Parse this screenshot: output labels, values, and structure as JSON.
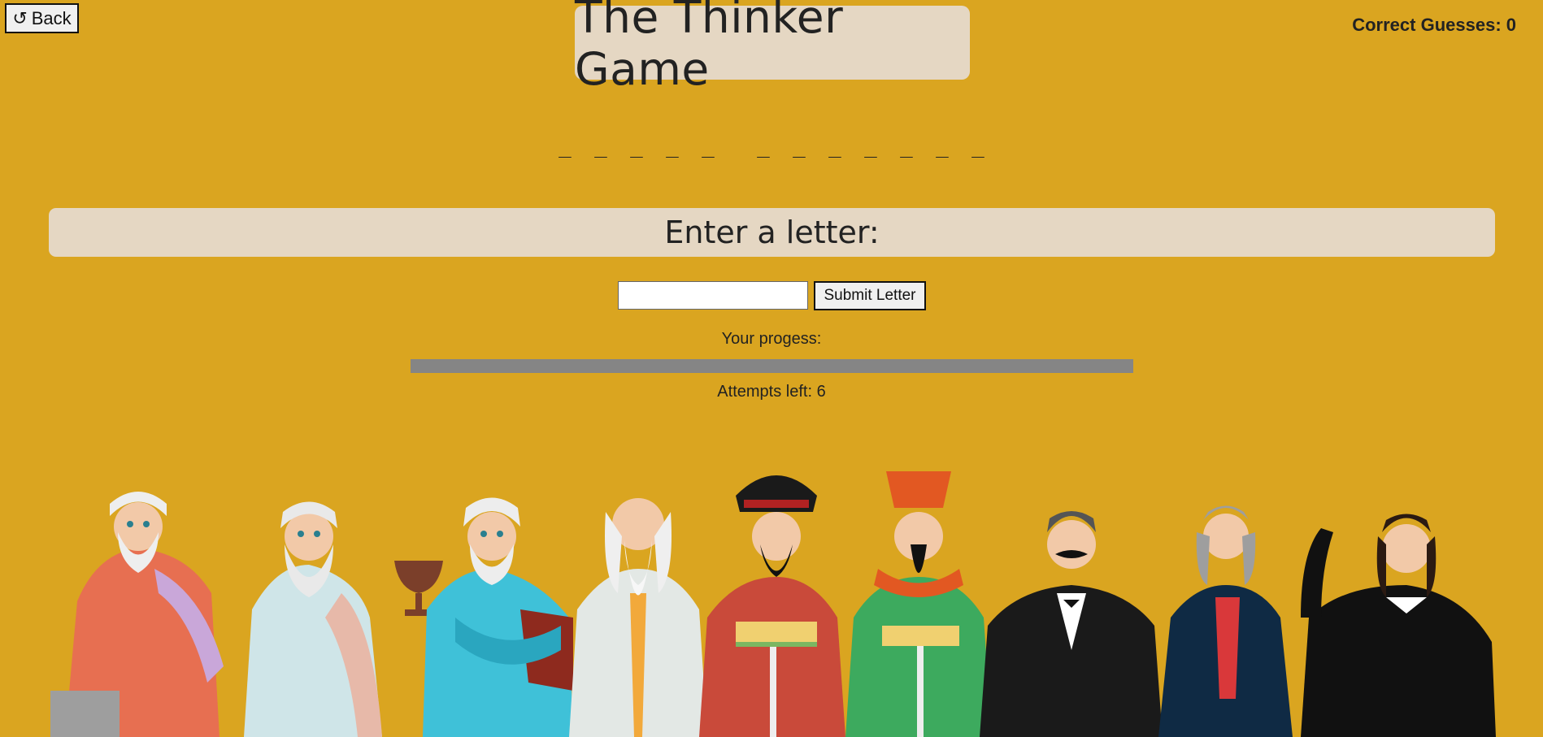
{
  "nav": {
    "back_label": "Back"
  },
  "score": {
    "label": "Correct Guesses: 0"
  },
  "title": "The Thinker Game",
  "word": {
    "first": [
      "_",
      "_",
      "_",
      "_",
      "_"
    ],
    "second": [
      "_",
      "_",
      "_",
      "_",
      "_",
      "_",
      "_"
    ]
  },
  "prompt": "Enter a letter:",
  "input": {
    "value": "",
    "placeholder": ""
  },
  "submit_label": "Submit Letter",
  "progress": {
    "label": "Your progess:",
    "fraction": 0
  },
  "attempts": "Attempts left: 6",
  "colors": {
    "background": "#DAA520",
    "panel": "#E5D7C3",
    "progress_track": "#858585"
  },
  "thinkers": [
    {
      "name": "thinker-plato"
    },
    {
      "name": "thinker-socrates"
    },
    {
      "name": "thinker-aristotle"
    },
    {
      "name": "thinker-laozi"
    },
    {
      "name": "thinker-confucius"
    },
    {
      "name": "thinker-sun-tzu"
    },
    {
      "name": "thinker-nietzsche"
    },
    {
      "name": "thinker-voltaire"
    },
    {
      "name": "thinker-descartes"
    }
  ]
}
